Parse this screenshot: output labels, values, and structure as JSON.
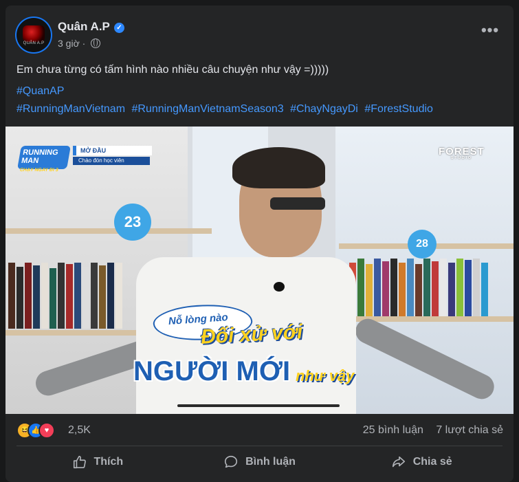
{
  "post": {
    "author": "Quân A.P",
    "avatar_caption": "QUÂN A.P",
    "verified_icon": "verified-badge-icon",
    "time": "3 giờ",
    "audience_icon": "globe-icon",
    "more_label": "•••",
    "text": "Em chưa từng có tấm hình nào nhiều câu chuyện như vậy =)))))",
    "hashtag_line1": "#QuanAP",
    "hashtags_line2": [
      "#RunningManVietnam",
      "#RunningManVietnamSeason3",
      "#ChayNgayDi",
      "#ForestStudio"
    ]
  },
  "image": {
    "show_logo": "RUNNING MAN",
    "show_logo_sub": "CHẠY NGAY ĐI 3",
    "segment_title": "MỞ ĐẦU",
    "segment_sub": "Chào đón học viên",
    "studio_brand": "FOREST",
    "studio_sub": "STUDIO",
    "shelf_number_left": "23",
    "shelf_number_right": "28",
    "caption_1": "Nỗ lòng nào",
    "caption_2": "Đối xử với",
    "caption_3": "NGƯỜI MỚI",
    "caption_4": "như vậy"
  },
  "engagement": {
    "reaction_count": "2,5K",
    "comments": "25 bình luận",
    "shares": "7 lượt chia sẻ",
    "reaction_icons": [
      "haha-icon",
      "like-icon",
      "love-icon"
    ]
  },
  "actions": {
    "like": "Thích",
    "comment": "Bình luận",
    "share": "Chia sẻ"
  },
  "colors": {
    "background": "#18191a",
    "card": "#242526",
    "text_primary": "#e4e6eb",
    "text_secondary": "#b0b3b8",
    "hashtag": "#4599ff"
  }
}
